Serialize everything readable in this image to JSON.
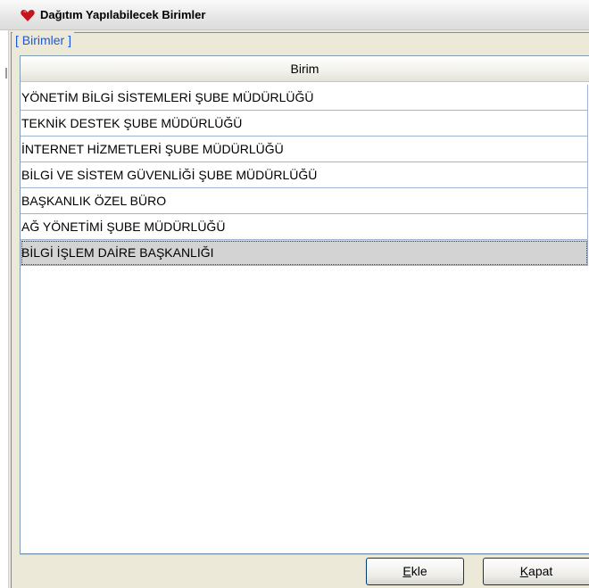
{
  "window": {
    "title": "Dağıtım Yapılabilecek Birimler",
    "app_icon": "red-heart-icon"
  },
  "group": {
    "label": "[ Birimler ]"
  },
  "table": {
    "column_header": "Birim",
    "rows": [
      "YÖNETİM BİLGİ SİSTEMLERİ ŞUBE MÜDÜRLÜĞÜ",
      "TEKNİK DESTEK ŞUBE MÜDÜRLÜĞÜ",
      "İNTERNET HİZMETLERİ ŞUBE MÜDÜRLÜĞÜ",
      "BİLGİ VE SİSTEM GÜVENLİĞİ ŞUBE MÜDÜRLÜĞÜ",
      "BAŞKANLIK ÖZEL BÜRO",
      "AĞ YÖNETİMİ ŞUBE MÜDÜRLÜĞÜ",
      "BİLGİ İŞLEM DAİRE BAŞKANLIĞI"
    ],
    "selected_index": 6
  },
  "buttons": {
    "ekle": {
      "mnemonic": "E",
      "rest": "kle"
    },
    "kapat": {
      "mnemonic": "K",
      "rest": "apat"
    }
  },
  "colors": {
    "group_label": "#1f56d8",
    "selected_row": "#d3d3d3"
  }
}
